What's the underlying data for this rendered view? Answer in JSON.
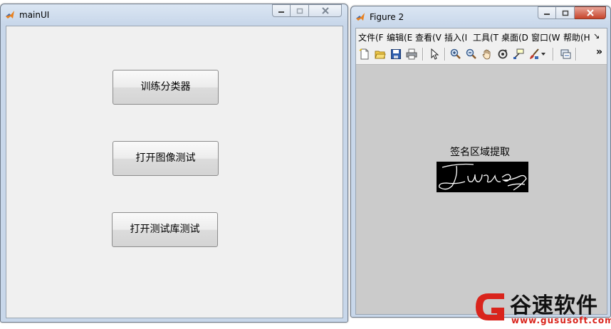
{
  "main_window": {
    "title": "mainUI",
    "buttons": {
      "train_label": "训练分类器",
      "open_image_label": "打开图像测试",
      "open_library_label": "打开测试库测试"
    }
  },
  "figure_window": {
    "title": "Figure 2",
    "menu": [
      "文件(F",
      "编辑(E",
      "查看(V",
      "插入(I",
      "工具(T",
      "桌面(D",
      "窗口(W",
      "帮助(H"
    ],
    "menu_overflow": "↘",
    "toolbar_overflow": "»",
    "plot_title": "签名区域提取"
  },
  "watermark": {
    "brand": "谷速软件",
    "url": "www.gususoft.com",
    "color": "#d9241c"
  }
}
